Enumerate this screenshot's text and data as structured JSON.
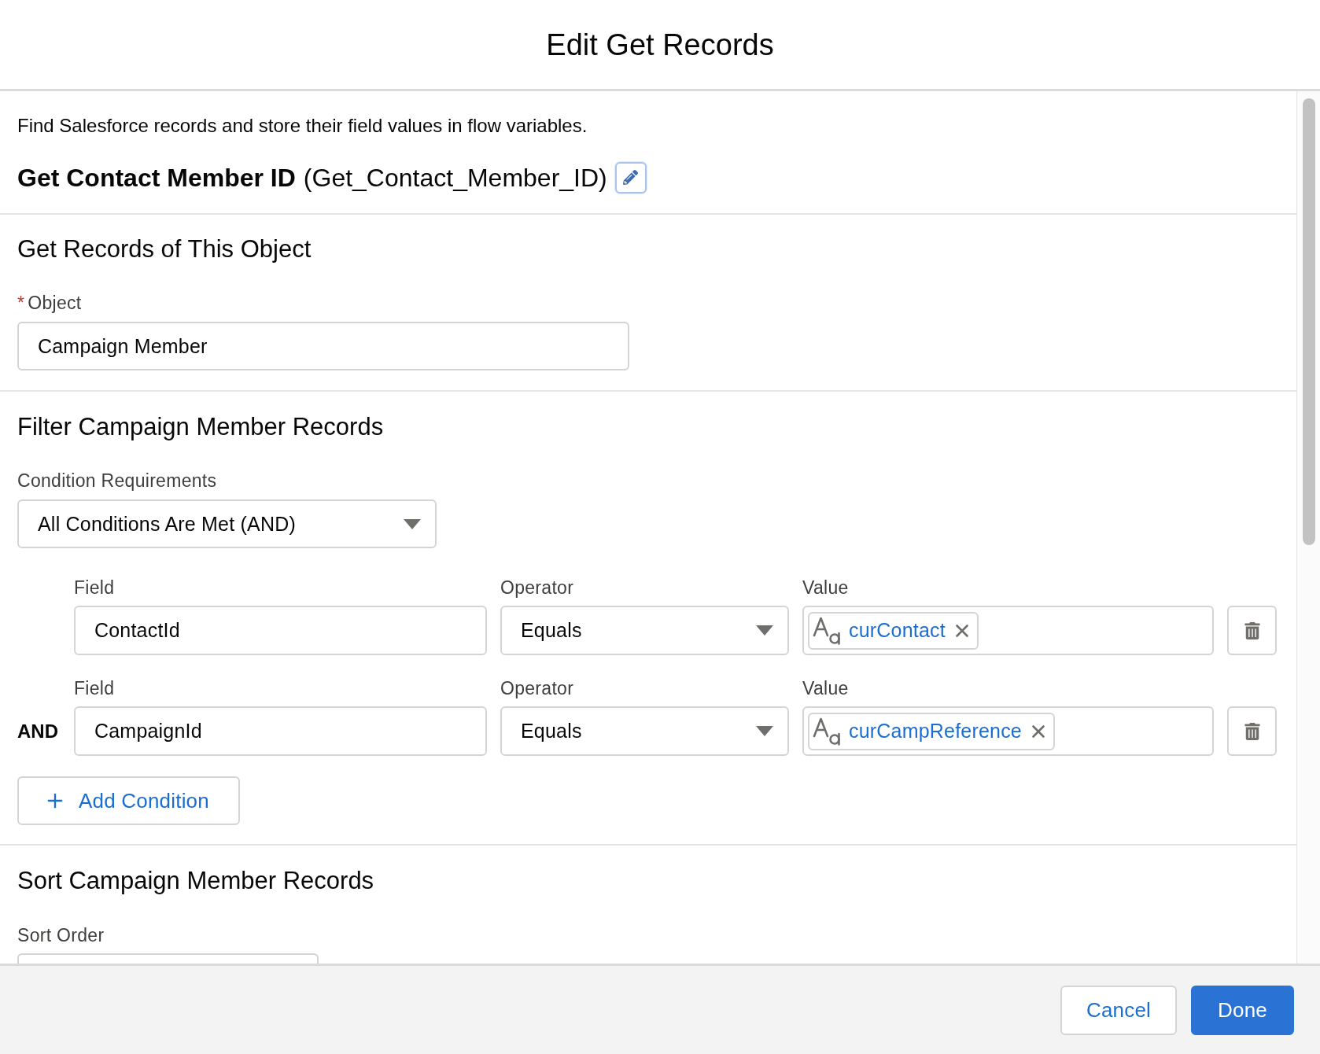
{
  "modal": {
    "title": "Edit Get Records"
  },
  "intro": {
    "description": "Find Salesforce records and store their field values in flow variables.",
    "element_label": "Get Contact Member ID",
    "api_name": "(Get_Contact_Member_ID)"
  },
  "object_section": {
    "heading": "Get Records of This Object",
    "object_field": {
      "required_mark": "*",
      "label": "Object",
      "value": "Campaign Member"
    }
  },
  "filter_section": {
    "heading": "Filter Campaign Member Records",
    "condition_requirements": {
      "label": "Condition Requirements",
      "value": "All Conditions Are Met (AND)"
    },
    "conditions": [
      {
        "field_label": "Field",
        "field": "ContactId",
        "operator_label": "Operator",
        "operator": "Equals",
        "value_label": "Value",
        "value": "curContact"
      },
      {
        "logic": "AND",
        "field_label": "Field",
        "field": "CampaignId",
        "operator_label": "Operator",
        "operator": "Equals",
        "value_label": "Value",
        "value": "curCampReference"
      }
    ],
    "add_condition_button": "Add Condition"
  },
  "sort_section": {
    "heading": "Sort Campaign Member Records",
    "sort_order_label": "Sort Order"
  },
  "footer": {
    "buttons": [
      {
        "label": "Cancel",
        "kind": "neutral"
      },
      {
        "label": "Done",
        "kind": "brand"
      }
    ]
  }
}
